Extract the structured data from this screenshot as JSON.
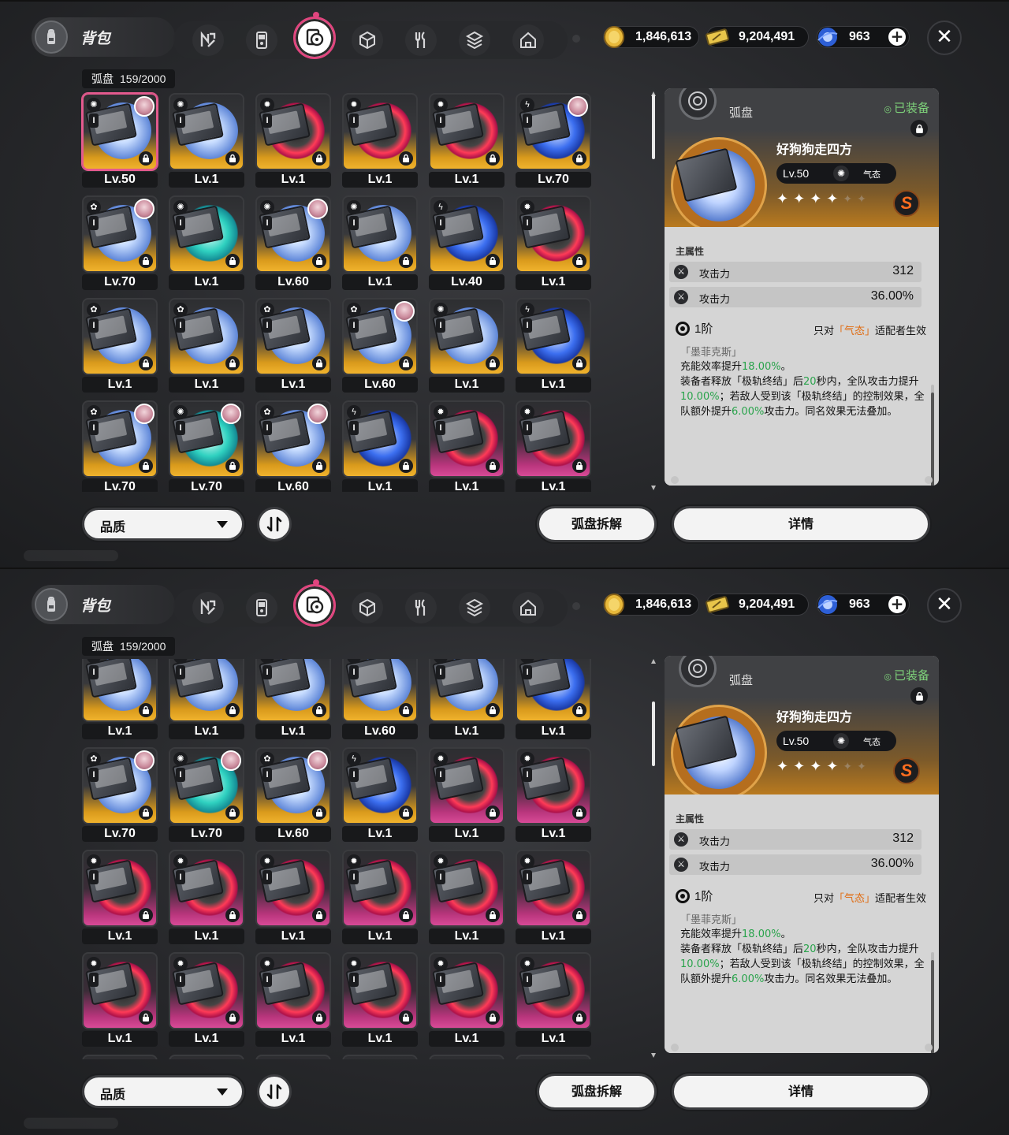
{
  "topbar": {
    "title": "背包",
    "tabs": [
      {
        "icon": "agent-icon"
      },
      {
        "icon": "console-icon"
      },
      {
        "icon": "drive-disc-icon",
        "active": true
      },
      {
        "icon": "cube-icon"
      },
      {
        "icon": "food-icon"
      },
      {
        "icon": "materials-icon"
      },
      {
        "icon": "home-icon"
      }
    ],
    "currencies": [
      {
        "icon": "coin-icon",
        "value": "1,846,613"
      },
      {
        "icon": "ticket-icon",
        "value": "9,204,491"
      },
      {
        "icon": "orb-icon",
        "value": "963"
      }
    ],
    "plus": "+",
    "close": "✕"
  },
  "inventory": {
    "label": "弧盘",
    "count": "159/2000"
  },
  "panels": [
    {
      "items": [
        {
          "lv": "Lv.50",
          "rank": "S",
          "disc": "ice",
          "elem": "✺",
          "avatar": true,
          "selected": true
        },
        {
          "lv": "Lv.1",
          "rank": "S",
          "disc": "ice",
          "elem": "✺",
          "avatar": false
        },
        {
          "lv": "Lv.1",
          "rank": "S",
          "disc": "fire",
          "elem": "✹",
          "avatar": false
        },
        {
          "lv": "Lv.1",
          "rank": "S",
          "disc": "fire",
          "elem": "✹",
          "avatar": false
        },
        {
          "lv": "Lv.1",
          "rank": "S",
          "disc": "fire",
          "elem": "✹",
          "avatar": false
        },
        {
          "lv": "Lv.70",
          "rank": "S",
          "disc": "elec",
          "elem": "ϟ",
          "avatar": true
        },
        {
          "lv": "Lv.70",
          "rank": "S",
          "disc": "ice",
          "elem": "✿",
          "avatar": true
        },
        {
          "lv": "Lv.1",
          "rank": "S",
          "disc": "cyan",
          "elem": "✺",
          "avatar": false
        },
        {
          "lv": "Lv.60",
          "rank": "S",
          "disc": "ice",
          "elem": "✺",
          "avatar": true
        },
        {
          "lv": "Lv.1",
          "rank": "S",
          "disc": "ice",
          "elem": "✺",
          "avatar": false
        },
        {
          "lv": "Lv.40",
          "rank": "S",
          "disc": "elec",
          "elem": "ϟ",
          "avatar": false
        },
        {
          "lv": "Lv.1",
          "rank": "S",
          "disc": "fire",
          "elem": "✹",
          "avatar": false
        },
        {
          "lv": "Lv.1",
          "rank": "S",
          "disc": "ice",
          "elem": "✿",
          "avatar": false
        },
        {
          "lv": "Lv.1",
          "rank": "S",
          "disc": "ice",
          "elem": "✿",
          "avatar": false
        },
        {
          "lv": "Lv.1",
          "rank": "S",
          "disc": "ice",
          "elem": "✿",
          "avatar": false
        },
        {
          "lv": "Lv.60",
          "rank": "S",
          "disc": "ice",
          "elem": "✿",
          "avatar": true
        },
        {
          "lv": "Lv.1",
          "rank": "S",
          "disc": "ice",
          "elem": "✺",
          "avatar": false
        },
        {
          "lv": "Lv.1",
          "rank": "S",
          "disc": "elec",
          "elem": "ϟ",
          "avatar": false
        },
        {
          "lv": "Lv.70",
          "rank": "S",
          "disc": "ice",
          "elem": "✿",
          "avatar": true
        },
        {
          "lv": "Lv.70",
          "rank": "S",
          "disc": "cyan",
          "elem": "✺",
          "avatar": true
        },
        {
          "lv": "Lv.60",
          "rank": "S",
          "disc": "ice",
          "elem": "✿",
          "avatar": true
        },
        {
          "lv": "Lv.1",
          "rank": "S",
          "disc": "elec",
          "elem": "ϟ",
          "avatar": false
        },
        {
          "lv": "Lv.1",
          "rank": "A",
          "disc": "fire",
          "elem": "✹",
          "avatar": false
        },
        {
          "lv": "Lv.1",
          "rank": "A",
          "disc": "fire",
          "elem": "✹",
          "avatar": false
        }
      ]
    },
    {
      "items": [
        {
          "lv": "Lv.1",
          "rank": "S",
          "disc": "ice",
          "elem": "✿",
          "avatar": false
        },
        {
          "lv": "Lv.1",
          "rank": "S",
          "disc": "ice",
          "elem": "✿",
          "avatar": false
        },
        {
          "lv": "Lv.1",
          "rank": "S",
          "disc": "ice",
          "elem": "✿",
          "avatar": false
        },
        {
          "lv": "Lv.60",
          "rank": "S",
          "disc": "ice",
          "elem": "✿",
          "avatar": false
        },
        {
          "lv": "Lv.1",
          "rank": "S",
          "disc": "ice",
          "elem": "✺",
          "avatar": false
        },
        {
          "lv": "Lv.1",
          "rank": "S",
          "disc": "elec",
          "elem": "ϟ",
          "avatar": false
        },
        {
          "lv": "Lv.70",
          "rank": "S",
          "disc": "ice",
          "elem": "✿",
          "avatar": true
        },
        {
          "lv": "Lv.70",
          "rank": "S",
          "disc": "cyan",
          "elem": "✺",
          "avatar": true
        },
        {
          "lv": "Lv.60",
          "rank": "S",
          "disc": "ice",
          "elem": "✿",
          "avatar": true
        },
        {
          "lv": "Lv.1",
          "rank": "S",
          "disc": "elec",
          "elem": "ϟ",
          "avatar": false
        },
        {
          "lv": "Lv.1",
          "rank": "A",
          "disc": "fire",
          "elem": "✹",
          "avatar": false
        },
        {
          "lv": "Lv.1",
          "rank": "A",
          "disc": "fire",
          "elem": "✹",
          "avatar": false
        },
        {
          "lv": "Lv.1",
          "rank": "A",
          "disc": "fire",
          "elem": "✹",
          "avatar": false
        },
        {
          "lv": "Lv.1",
          "rank": "A",
          "disc": "fire",
          "elem": "✹",
          "avatar": false
        },
        {
          "lv": "Lv.1",
          "rank": "A",
          "disc": "fire",
          "elem": "✹",
          "avatar": false
        },
        {
          "lv": "Lv.1",
          "rank": "A",
          "disc": "fire",
          "elem": "✹",
          "avatar": false
        },
        {
          "lv": "Lv.1",
          "rank": "A",
          "disc": "fire",
          "elem": "✹",
          "avatar": false
        },
        {
          "lv": "Lv.1",
          "rank": "A",
          "disc": "fire",
          "elem": "✹",
          "avatar": false
        },
        {
          "lv": "Lv.1",
          "rank": "A",
          "disc": "fire",
          "elem": "✹",
          "avatar": false
        },
        {
          "lv": "Lv.1",
          "rank": "A",
          "disc": "fire",
          "elem": "✹",
          "avatar": false
        },
        {
          "lv": "Lv.1",
          "rank": "A",
          "disc": "fire",
          "elem": "✹",
          "avatar": false
        },
        {
          "lv": "Lv.1",
          "rank": "A",
          "disc": "fire",
          "elem": "✹",
          "avatar": false
        },
        {
          "lv": "Lv.1",
          "rank": "A",
          "disc": "fire",
          "elem": "✹",
          "avatar": false
        },
        {
          "lv": "Lv.1",
          "rank": "A",
          "disc": "fire",
          "elem": "✹",
          "avatar": false
        },
        {
          "lv": "",
          "rank": "A",
          "disc": "fire",
          "elem": "✹",
          "avatar": false
        },
        {
          "lv": "",
          "rank": "A",
          "disc": "fire",
          "elem": "✹",
          "avatar": false
        },
        {
          "lv": "",
          "rank": "A",
          "disc": "fire",
          "elem": "✹",
          "avatar": false
        },
        {
          "lv": "",
          "rank": "S",
          "disc": "ice",
          "elem": "✺",
          "avatar": false
        },
        {
          "lv": "",
          "rank": "S",
          "disc": "cyan",
          "elem": "✺",
          "avatar": false
        },
        {
          "lv": "",
          "rank": "S",
          "disc": "ice",
          "elem": "✿",
          "avatar": false
        }
      ]
    }
  ],
  "detail": {
    "category": "弧盘",
    "equipped": "已装备",
    "name": "好狗狗走四方",
    "level": "Lv.50",
    "attribute": "气态",
    "stars_filled": 4,
    "stars_total": 6,
    "rank": "S",
    "main_stats_label": "主属性",
    "stats": [
      {
        "name": "攻击力",
        "value": "312"
      },
      {
        "name": "攻击力",
        "value": "36.00%"
      }
    ],
    "tier": "1阶",
    "condition_prefix": "只对",
    "condition_highlight": "「气态」",
    "condition_suffix": "适配者生效",
    "set_name": "「墨菲克斯」",
    "desc": [
      {
        "t": "充能效率提升",
        "g": false
      },
      {
        "t": "18.00%",
        "g": true
      },
      {
        "t": "。",
        "g": false
      },
      {
        "t": "装备者释放「极轨终结」后",
        "g": false,
        "br": true
      },
      {
        "t": "20",
        "g": true
      },
      {
        "t": "秒内，全队攻击力提升",
        "g": false
      },
      {
        "t": "10.00%",
        "g": true
      },
      {
        "t": "；若敌人受到该「极轨终结」的控制效果，全队额外提升",
        "g": false
      },
      {
        "t": "6.00%",
        "g": true
      },
      {
        "t": "攻击力。同名效果无法叠加。",
        "g": false
      }
    ]
  },
  "bottom": {
    "filter": "品质",
    "dismantle": "弧盘拆解",
    "details": "详情"
  },
  "colors": {
    "accent": "#e0457e",
    "rank_s": "#f0b32d",
    "rank_a": "#d84a97",
    "highlight_green": "#29a34b",
    "highlight_orange": "#e06b10",
    "equipped_green": "#7ed27a"
  }
}
